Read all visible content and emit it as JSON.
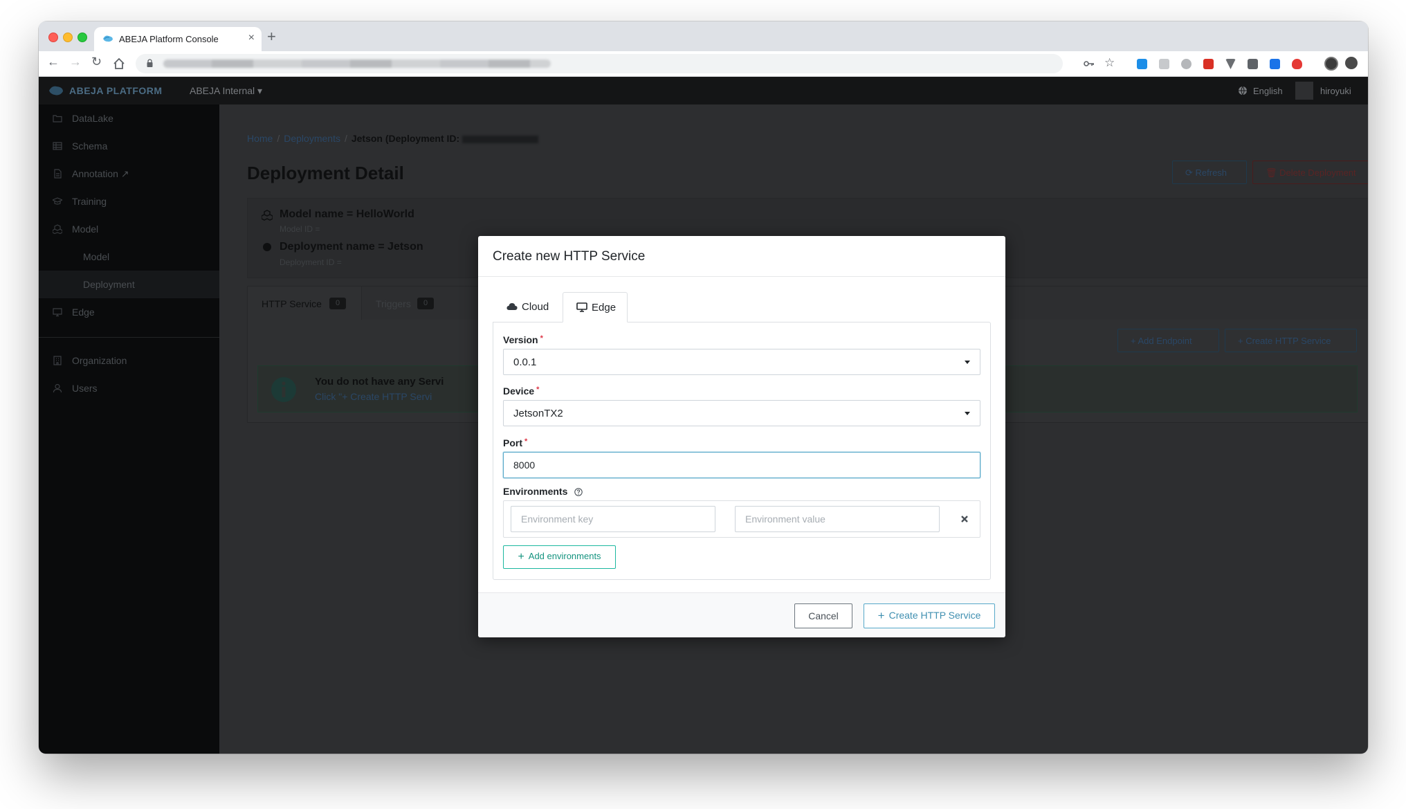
{
  "browser": {
    "tab_title": "ABEJA Platform Console",
    "tab_close": "×",
    "new_tab": "+"
  },
  "app": {
    "logo": "ABEJA PLATFORM",
    "organization": "ABEJA Internal ▾",
    "language": "English",
    "user": "hiroyuki"
  },
  "sidebar": {
    "items": [
      {
        "label": "DataLake",
        "icon": "folder-icon"
      },
      {
        "label": "Schema",
        "icon": "table-icon"
      },
      {
        "label": "Annotation ↗",
        "icon": "document-icon"
      },
      {
        "label": "Training",
        "icon": "graduation-cap-icon"
      },
      {
        "label": "Model",
        "icon": "cubes-icon"
      },
      {
        "label": "Model",
        "icon": ""
      },
      {
        "label": "Deployment",
        "icon": ""
      },
      {
        "label": "Edge",
        "icon": "desktop-icon"
      },
      {
        "label": "Organization",
        "icon": "building-icon"
      },
      {
        "label": "Users",
        "icon": "user-icon"
      }
    ]
  },
  "main": {
    "breadcrumb": {
      "home": "Home",
      "deployments": "Deployments",
      "current": "Jetson (Deployment ID:"
    },
    "page_title": "Deployment Detail",
    "refresh_label": "⟳  Refresh",
    "delete_label": "🗑  Delete Deployment",
    "model_name": "Model name = HelloWorld",
    "model_id": "Model ID =",
    "deployment_name": "Deployment name = Jetson",
    "deployment_id": "Deployment ID =",
    "tabs": [
      {
        "label": "HTTP Service",
        "count": "0"
      },
      {
        "label": "Triggers",
        "count": "0"
      }
    ],
    "add_endpoint_label": "+  Add Endpoint",
    "create_http_label": "+  Create HTTP Service",
    "alert_title": "You do not have any Servi",
    "alert_text": "Click \"+ Create HTTP Servi"
  },
  "modal": {
    "title": "Create new HTTP Service",
    "tabs": [
      {
        "label": "Cloud",
        "icon": "cloud-icon"
      },
      {
        "label": "Edge",
        "icon": "desktop-icon",
        "active": true
      }
    ],
    "version_label": "Version",
    "version_value": "0.0.1",
    "device_label": "Device",
    "device_value": "JetsonTX2",
    "port_label": "Port",
    "port_value": "8000",
    "env_label": "Environments",
    "required_mark": "*",
    "env_key_placeholder": "Environment key",
    "env_value_placeholder": "Environment value",
    "add_env_label": "Add environments",
    "cancel_label": "Cancel",
    "create_label": "Create HTTP Service"
  },
  "colors": {
    "accent_teal": "#1bb79f",
    "primary_blue": "#56a8c9",
    "required_red": "#dc3545"
  }
}
